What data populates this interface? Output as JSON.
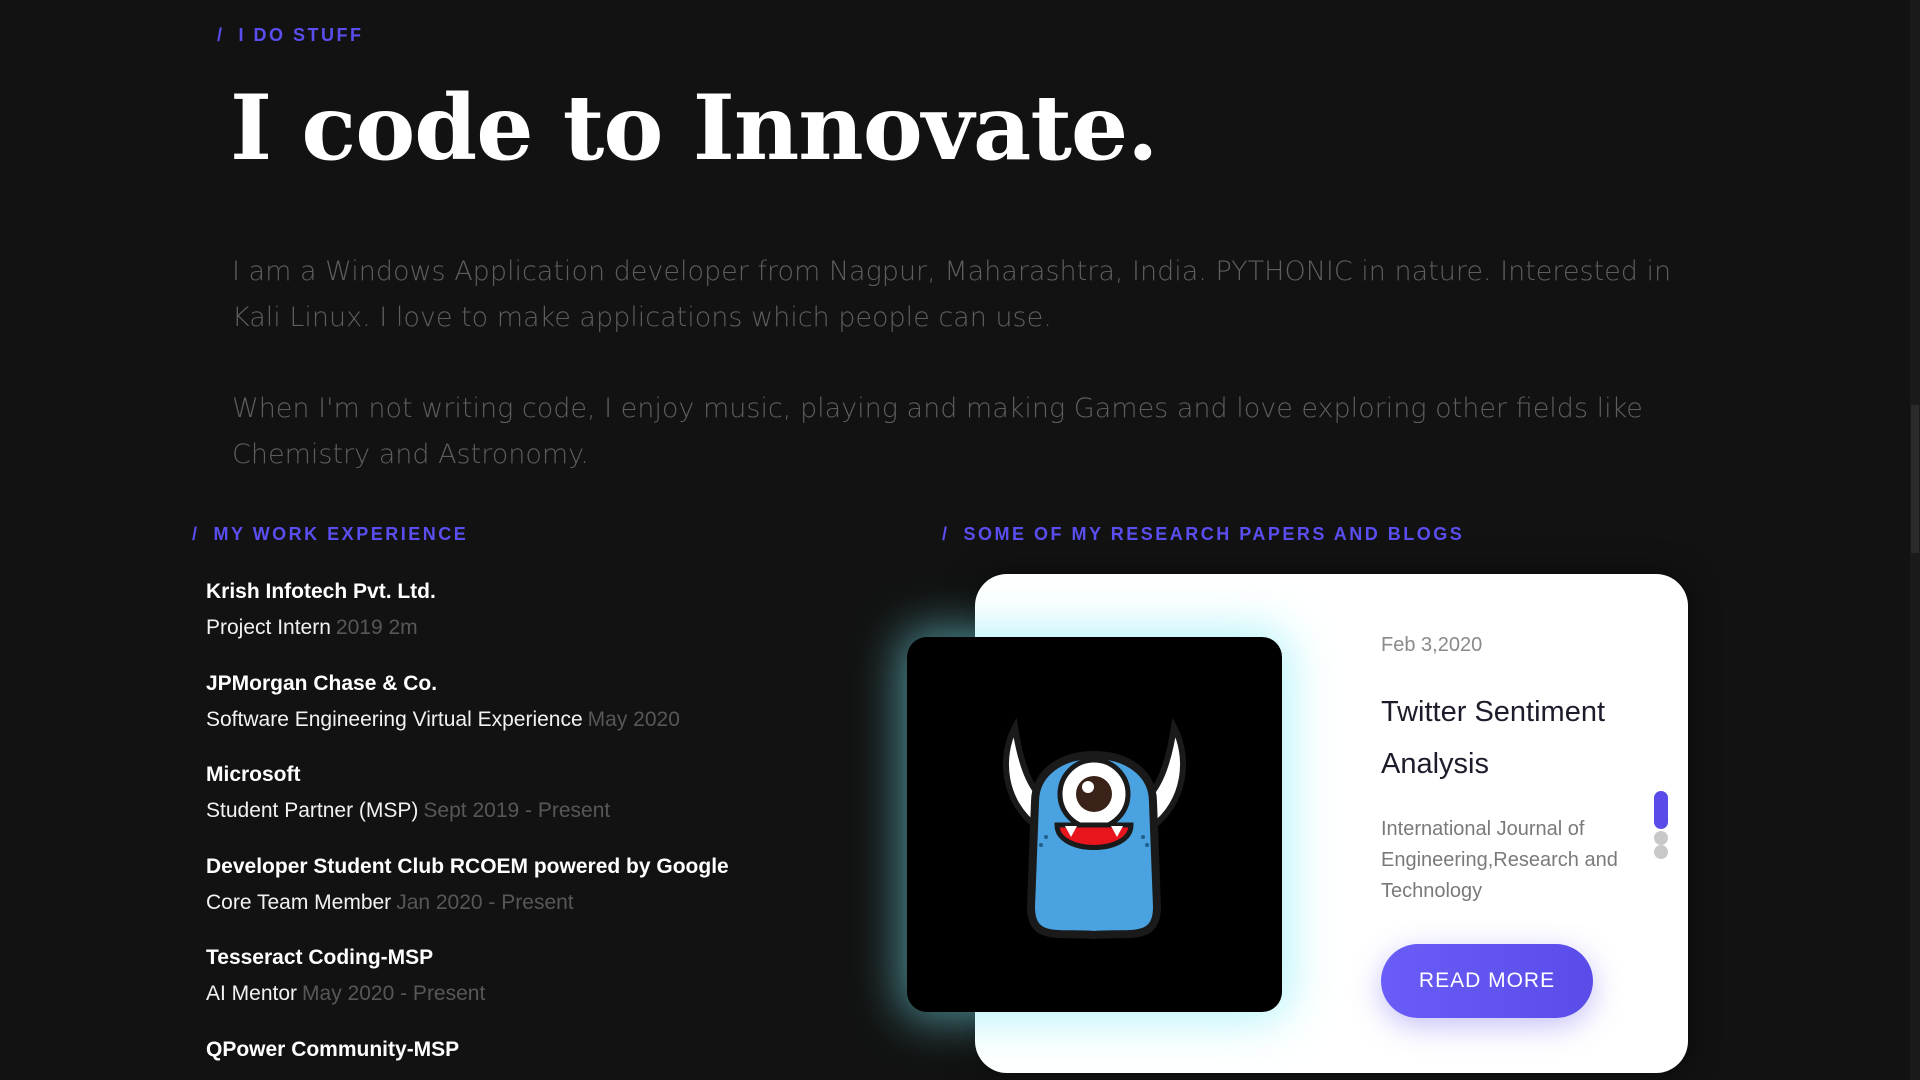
{
  "sections": {
    "stuff_label": "I DO STUFF",
    "work_label": "MY WORK EXPERIENCE",
    "papers_label": "SOME OF MY RESEARCH PAPERS AND BLOGS",
    "slash": "/"
  },
  "hero": {
    "title": "I code to Innovate.",
    "intro_1": "I am a Windows Application developer from Nagpur, Maharashtra, India. PYTHONIC in nature. Interested in Kali Linux. I love to make applications which people can use.",
    "intro_2": "When I'm not writing code, I enjoy music, playing and making Games and love exploring other fields like Chemistry and Astronomy."
  },
  "experience": [
    {
      "company": "Krish Infotech Pvt. Ltd.",
      "role": "Project Intern",
      "period": "2019 2m"
    },
    {
      "company": "JPMorgan Chase & Co.",
      "role": "Software Engineering Virtual Experience",
      "period": "May 2020"
    },
    {
      "company": "Microsoft",
      "role": "Student Partner (MSP)",
      "period": "Sept 2019 - Present"
    },
    {
      "company": "Developer Student Club RCOEM powered by Google",
      "role": "Core Team Member",
      "period": "Jan 2020 - Present"
    },
    {
      "company": "Tesseract Coding-MSP",
      "role": "AI Mentor",
      "period": "May 2020 - Present"
    },
    {
      "company": "QPower Community-MSP",
      "role": "",
      "period": ""
    }
  ],
  "card": {
    "date": "Feb 3,2020",
    "title": "Twitter Sentiment Analysis",
    "description": "International Journal of Engineering,Research and Technology",
    "button_label": "READ MORE",
    "image_icon": "one-eyed-monster-icon",
    "pager": {
      "total": 3,
      "active": 1
    }
  },
  "colors": {
    "accent": "#5b4ef0",
    "background": "#121212",
    "card_glow": "#78ebf5"
  }
}
